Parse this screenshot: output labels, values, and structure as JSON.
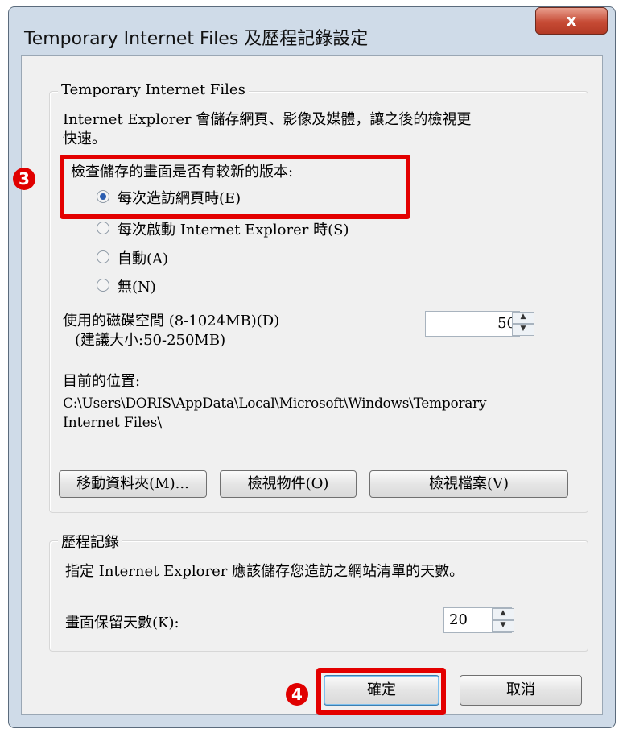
{
  "window": {
    "title": "Temporary Internet Files 及歷程記錄設定",
    "close_label": "x"
  },
  "tif": {
    "group_title": "Temporary Internet Files",
    "description_line1": "Internet Explorer 會儲存網頁、影像及媒體，讓之後的檢視更",
    "description_line2": "快速。",
    "check_label": "檢查儲存的畫面是否有較新的版本:",
    "options": [
      {
        "label": "每次造訪網頁時(E)",
        "selected": true
      },
      {
        "label": "每次啟動 Internet Explorer 時(S)",
        "selected": false
      },
      {
        "label": "自動(A)",
        "selected": false
      },
      {
        "label": "無(N)",
        "selected": false
      }
    ],
    "disk_label": "使用的磁碟空間 (8-1024MB)(D)",
    "disk_hint": "(建議大小:50-250MB)",
    "disk_value": "50",
    "location_label": "目前的位置:",
    "location_path_line1": "C:\\Users\\DORIS\\AppData\\Local\\Microsoft\\Windows\\Temporary",
    "location_path_line2": "Internet Files\\",
    "move_folder_button": "移動資料夾(M)...",
    "view_objects_button": "檢視物件(O)",
    "view_files_button": "檢視檔案(V)"
  },
  "history": {
    "group_title": "歷程記錄",
    "description": "指定 Internet Explorer 應該儲存您造訪之網站清單的天數。",
    "days_label": "畫面保留天數(K):",
    "days_value": "20"
  },
  "footer": {
    "ok_button": "確定",
    "cancel_button": "取消"
  },
  "annotations": {
    "badge_3": "3",
    "badge_4": "4",
    "highlight_color": "#e30000"
  },
  "icons": {
    "radio_selected": "radio-selected-icon",
    "spin": "spin-arrows-icon"
  }
}
